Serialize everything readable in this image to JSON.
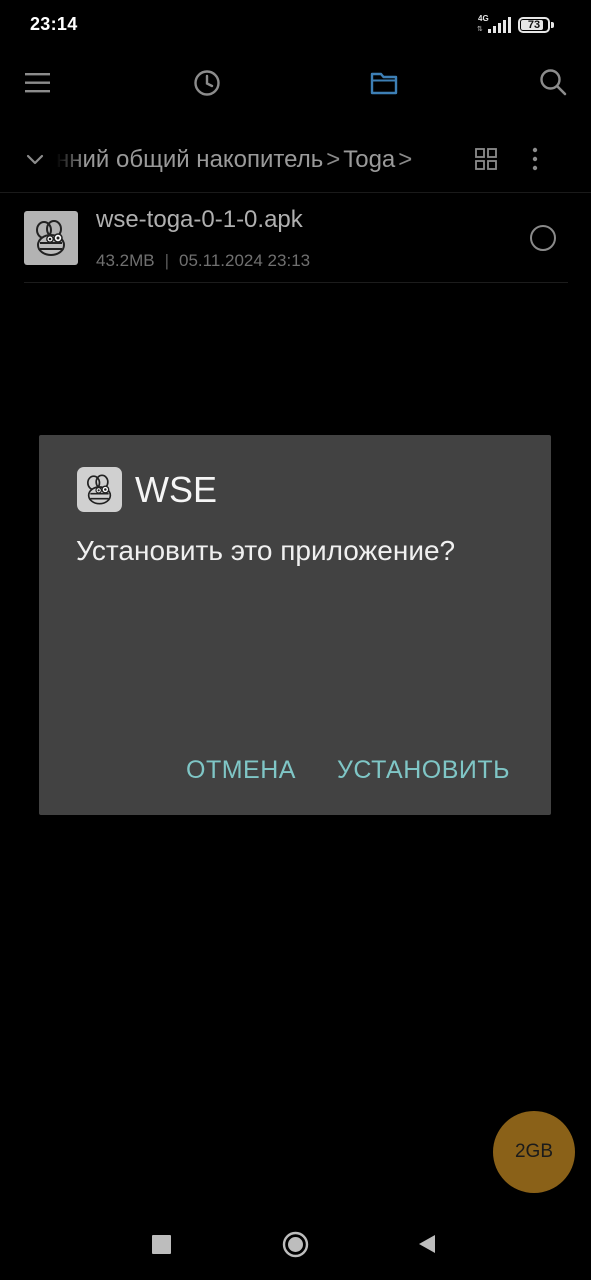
{
  "status_bar": {
    "time": "23:14",
    "network": "4G",
    "battery": "73"
  },
  "toolbar": {
    "icons": [
      "menu-icon",
      "clock-icon",
      "folder-icon",
      "search-icon"
    ],
    "active_color": "#3d7fb5"
  },
  "breadcrumb": {
    "parts": [
      "нний общий накопитель",
      "Toga"
    ],
    "separator": ">"
  },
  "file": {
    "name": "wse-toga-0-1-0.apk",
    "size": "43.2MB",
    "meta_separator": "|",
    "date": "05.11.2024 23:13"
  },
  "dialog": {
    "app_name": "WSE",
    "question": "Установить это приложение?",
    "cancel_label": "ОТМЕНА",
    "install_label": "УСТАНОВИТЬ",
    "button_color": "#7fc6c6"
  },
  "storage_badge": {
    "label": "2GB",
    "color": "#8a6118"
  },
  "nav": {
    "icons": [
      "recents-icon",
      "home-icon",
      "back-icon"
    ]
  }
}
